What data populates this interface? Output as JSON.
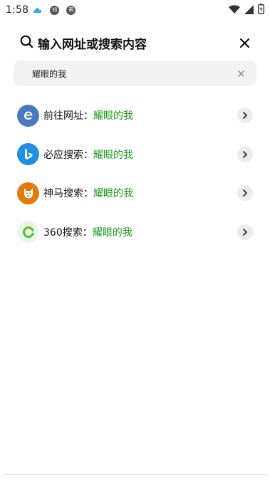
{
  "status_bar": {
    "time": "1:58",
    "icons": [
      "cloud-icon",
      "notification-icon",
      "notification-icon",
      "wifi-icon",
      "signal-icon",
      "battery-icon"
    ],
    "notif_1_text": "知",
    "notif_2_text": "萌"
  },
  "header": {
    "title": "输入网址或搜索内容"
  },
  "search": {
    "value": "耀眼的我"
  },
  "suggestions": [
    {
      "prefix": "前往网址：",
      "keyword": "耀眼的我",
      "icon": "ie-icon",
      "color": "#4a78c2"
    },
    {
      "prefix": "必应搜索：",
      "keyword": "耀眼的我",
      "icon": "bing-icon",
      "color": "#1f8fe0"
    },
    {
      "prefix": "神马搜索：",
      "keyword": "耀眼的我",
      "icon": "shenma-icon",
      "color": "#e27a0c"
    },
    {
      "prefix": "360搜索：",
      "keyword": "耀眼的我",
      "icon": "360-icon",
      "color": "#3dbb3d"
    }
  ],
  "colors": {
    "keyword": "#1a9a1a",
    "search_bg": "#f2f2f2"
  }
}
